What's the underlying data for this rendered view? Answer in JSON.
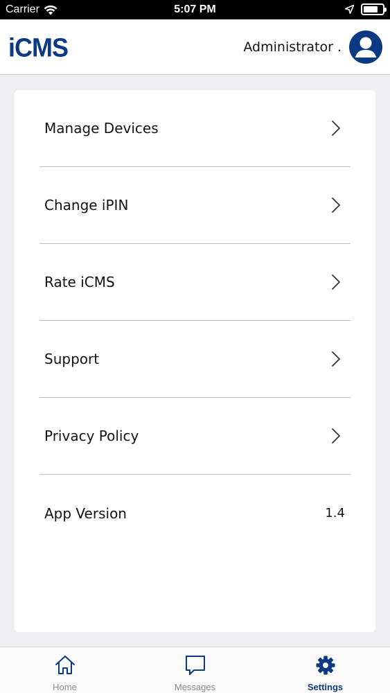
{
  "status_bar": {
    "carrier": "Carrier",
    "time": "5:07 PM",
    "battery_level": 0.75
  },
  "header": {
    "logo": "iCMS",
    "user_name": "Administrator ."
  },
  "settings": {
    "items": [
      {
        "label": "Manage Devices",
        "icon": "chevron-right-icon"
      },
      {
        "label": "Change iPIN",
        "icon": "chevron-right-icon"
      },
      {
        "label": "Rate iCMS",
        "icon": "chevron-right-icon"
      },
      {
        "label": "Support",
        "icon": "chevron-right-icon"
      },
      {
        "label": "Privacy Policy",
        "icon": "chevron-right-icon"
      },
      {
        "label": "App Version",
        "value": "1.4"
      }
    ]
  },
  "tabs": [
    {
      "label": "Home",
      "icon": "home-icon"
    },
    {
      "label": "Messages",
      "icon": "message-icon"
    },
    {
      "label": "Settings",
      "icon": "gear-icon",
      "active": true
    }
  ],
  "colors": {
    "brand": "#0b3a84",
    "inactive_tab": "#888888",
    "background": "#efeff1"
  }
}
